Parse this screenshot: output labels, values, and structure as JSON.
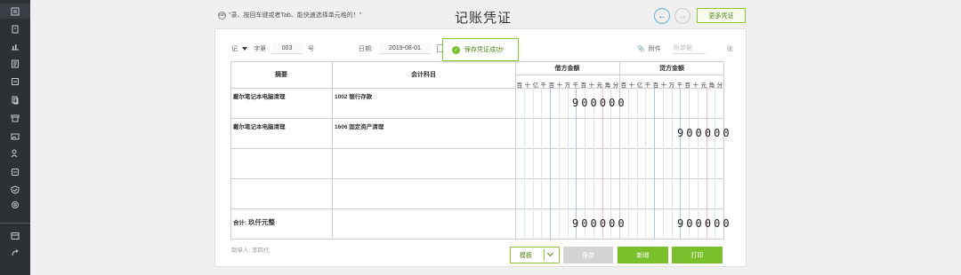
{
  "header": {
    "hint": "\"录、按回车键或者Tab、能快速选择单元格的！\"",
    "hint_icon_label": "tab",
    "title": "记账凭证",
    "more_label": "更多凭证"
  },
  "voucher": {
    "type": "记",
    "word_label": "字第",
    "number": "003",
    "number_suffix": "号",
    "date_label": "日期:",
    "date": "2019-08-01",
    "attach_label": "附件",
    "attach_placeholder": "附单据",
    "attach_unit": "张"
  },
  "toast": {
    "message": "保存凭证成功!"
  },
  "table": {
    "col_summary": "摘要",
    "col_account": "会计科目",
    "col_debit": "借方金额",
    "col_credit": "贷方金额",
    "digits": [
      "百",
      "十",
      "亿",
      "千",
      "百",
      "十",
      "万",
      "千",
      "百",
      "十",
      "元",
      "角",
      "分"
    ],
    "rows": [
      {
        "summary": "戴尔笔记本电脑清理",
        "account": "1002 银行存款",
        "debit": "900000",
        "credit": ""
      },
      {
        "summary": "戴尔笔记本电脑清理",
        "account": "1606 固定资产清理",
        "debit": "",
        "credit": "900000"
      },
      {
        "summary": "",
        "account": "",
        "debit": "",
        "credit": ""
      },
      {
        "summary": "",
        "account": "",
        "debit": "",
        "credit": ""
      }
    ],
    "total_label": "合计:",
    "total_words": "玖仟元整",
    "total_debit": "900000",
    "total_credit": "900000"
  },
  "footer": {
    "maker": "制单人: 李四代",
    "template_label": "模板",
    "save_label": "保存",
    "new_label": "新增",
    "print_label": "打印"
  },
  "colors": {
    "accent": "#7ac02c",
    "nav_blue": "#3a8fd8",
    "sidebar": "#2d3035"
  }
}
